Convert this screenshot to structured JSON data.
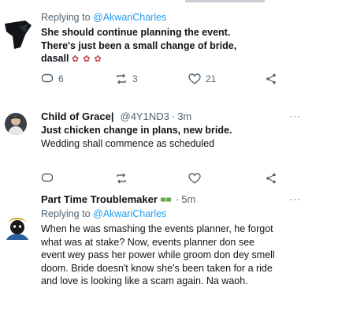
{
  "tweet1": {
    "reply_prefix": "Replying to",
    "reply_handle": "@AkwariCharles",
    "line1": "She should continue planning the event.",
    "line2": "There's just been a small change of bride,",
    "line3_text": "dasall",
    "line3_emojis": "✿ ✿ ✿",
    "reply_count": "6",
    "retweet_count": "3",
    "like_count": "21"
  },
  "tweet2": {
    "name": "Child of Grace|",
    "handle": "@4Y1ND3",
    "dot": "·",
    "time": "3m",
    "more": "···",
    "line1": "Just chicken change in plans, new bride.",
    "line2": "Wedding shall commence as scheduled"
  },
  "tweet3": {
    "name": "Part Time Troublemaker",
    "dot": "·",
    "time": "5m",
    "more": "···",
    "reply_prefix": "Replying to",
    "reply_handle": "@AkwariCharles",
    "body": "When he was smashing the events planner, he forgot what was at stake? Now, events planner don see event wey pass her power while groom don dey smell doom. Bride doesn't know she's been taken for a ride and love is looking like a scam again. Na waoh."
  },
  "colors": {
    "accent": "#1d9bf0",
    "muted": "#536471",
    "text": "#0f1419"
  }
}
